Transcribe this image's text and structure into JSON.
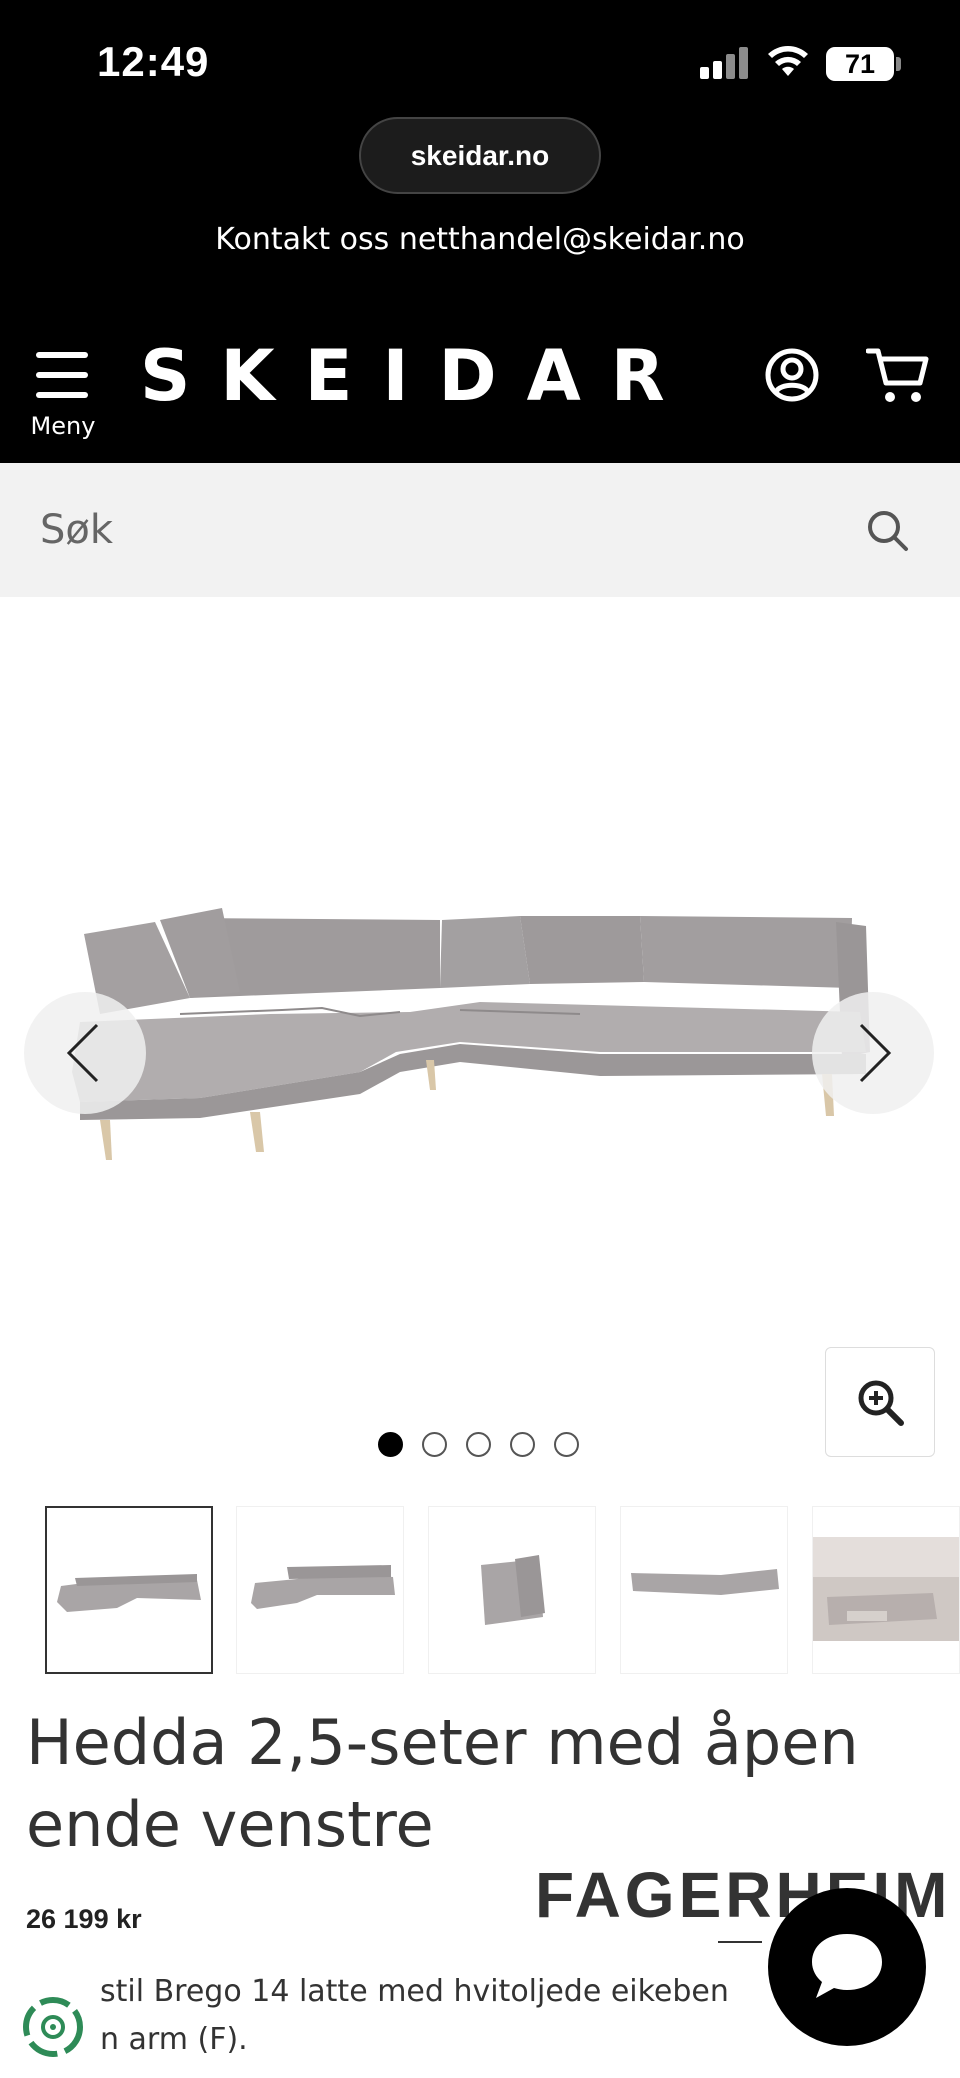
{
  "status_bar": {
    "time": "12:49",
    "battery": "71"
  },
  "browser": {
    "url": "skeidar.no"
  },
  "header": {
    "contact": "Kontakt oss netthandel@skeidar.no",
    "menu_label": "Meny",
    "logo": "SKEIDAR",
    "icons": [
      "menu-icon",
      "account-icon",
      "cart-icon"
    ]
  },
  "search": {
    "placeholder": "Søk"
  },
  "gallery": {
    "image_count": 5,
    "active_index": 0
  },
  "product": {
    "title": "Hedda 2,5-seter med åpen ende venstre",
    "price": "26 199 kr",
    "brand": "FAGERHEIM",
    "description": "stil Brego 14 latte med hvitoljede eikeben",
    "description_line2": "n arm (F)."
  },
  "colors": {
    "header_bg": "#000000",
    "search_bg": "#f2f2f2",
    "sofa_fabric": "#a9a5a6",
    "eco_badge": "#2e8b57"
  }
}
